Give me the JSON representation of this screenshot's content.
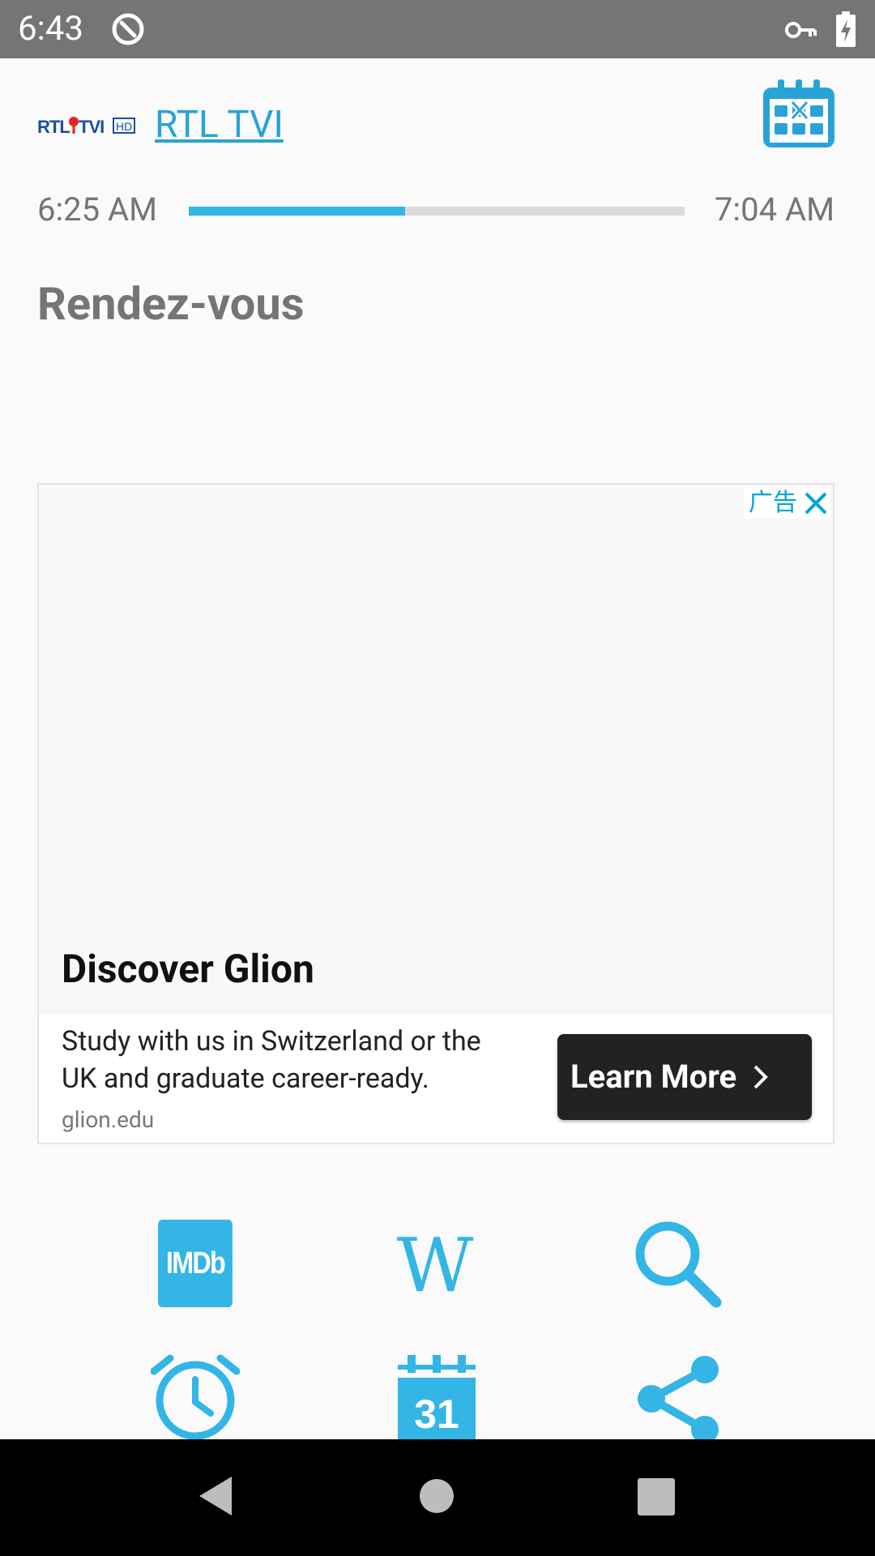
{
  "status_bar": {
    "time": "6:43",
    "icons": [
      "do-not-disturb-icon",
      "vpn-key-icon",
      "battery-charging-icon"
    ]
  },
  "header": {
    "channel_logo_text": "RTL TVI HD",
    "channel_name": "RTL TVI",
    "calendar_icon": "calendar-x-icon"
  },
  "schedule": {
    "start_time": "6:25 AM",
    "end_time": "7:04 AM",
    "progress_percent": 43.6
  },
  "program": {
    "title": "Rendez-vous"
  },
  "ad": {
    "label": "广告",
    "headline": "Discover Glion",
    "body": "Study with us in Switzerland or the UK and graduate career-ready.",
    "domain": "glion.edu",
    "cta": "Learn More"
  },
  "actions": [
    {
      "name": "imdb",
      "label": "IMDb",
      "icon": "imdb-icon"
    },
    {
      "name": "wikipedia",
      "label": "W",
      "icon": "wikipedia-icon"
    },
    {
      "name": "search",
      "icon": "search-icon"
    },
    {
      "name": "alarm",
      "icon": "alarm-clock-icon"
    },
    {
      "name": "calendar",
      "label": "31",
      "icon": "calendar-icon"
    },
    {
      "name": "share",
      "icon": "share-icon"
    }
  ],
  "nav_bar": {
    "icons": [
      "back-icon",
      "home-icon",
      "recents-icon"
    ]
  },
  "colors": {
    "accent": "#33b5e5",
    "link": "#29a3d6",
    "status_bar": "#757575",
    "nav_bar": "#000000",
    "ad_cta": "#222222"
  }
}
